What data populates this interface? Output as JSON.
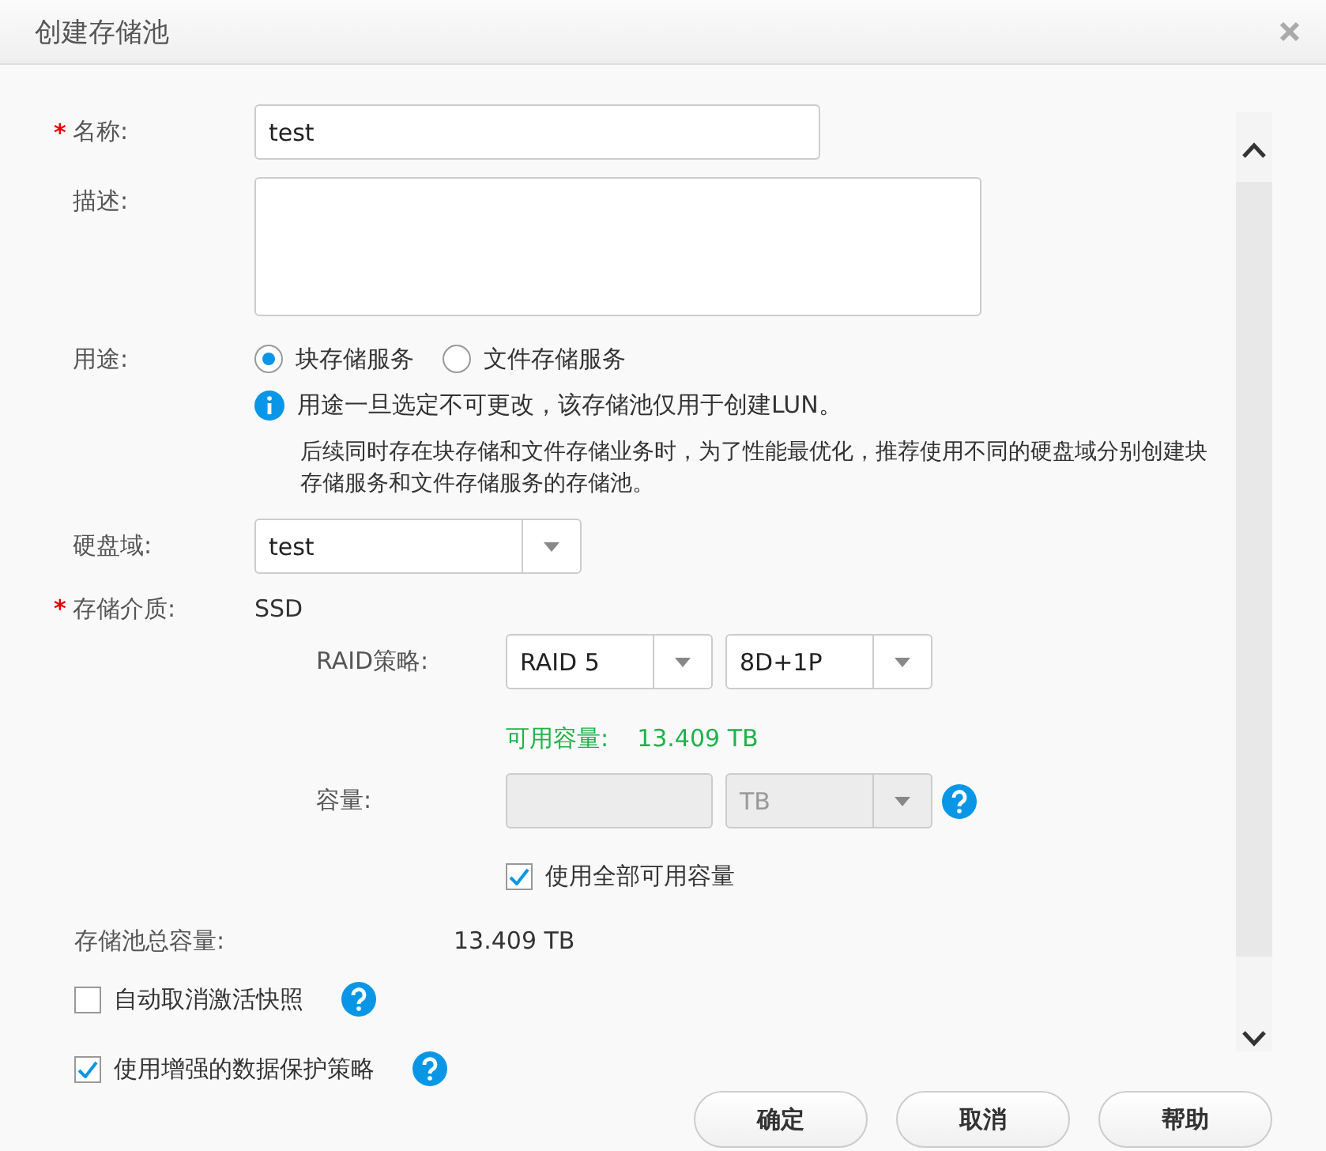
{
  "dialog": {
    "title": "创建存储池"
  },
  "name": {
    "label": "名称:",
    "required_mark": "*",
    "value": "test"
  },
  "description": {
    "label": "描述:"
  },
  "usage": {
    "label": "用途:",
    "options": [
      {
        "label": "块存储服务",
        "selected": true
      },
      {
        "label": "文件存储服务",
        "selected": false
      }
    ],
    "info": "用途一旦选定不可更改，该存储池仅用于创建LUN。",
    "note": "后续同时存在块存储和文件存储业务时，为了性能最优化，推荐使用不同的硬盘域分别创建块存储服务和文件存储服务的存储池。"
  },
  "disk_domain": {
    "label": "硬盘域:",
    "value": "test"
  },
  "storage_medium": {
    "label": "存储介质:",
    "required_mark": "*",
    "value": "SSD"
  },
  "raid": {
    "label": "RAID策略:",
    "level": "RAID 5",
    "layout": "8D+1P"
  },
  "available": {
    "label": "可用容量:",
    "value": "13.409 TB"
  },
  "capacity": {
    "label": "容量:",
    "unit": "TB",
    "disabled": true
  },
  "use_all": {
    "label": "使用全部可用容量",
    "checked": true
  },
  "total": {
    "label": "存储池总容量:",
    "value": "13.409 TB"
  },
  "options": [
    {
      "label": "自动取消激活快照",
      "checked": false
    },
    {
      "label": "使用增强的数据保护策略",
      "checked": true
    }
  ],
  "buttons": [
    "确定",
    "取消",
    "帮助"
  ]
}
